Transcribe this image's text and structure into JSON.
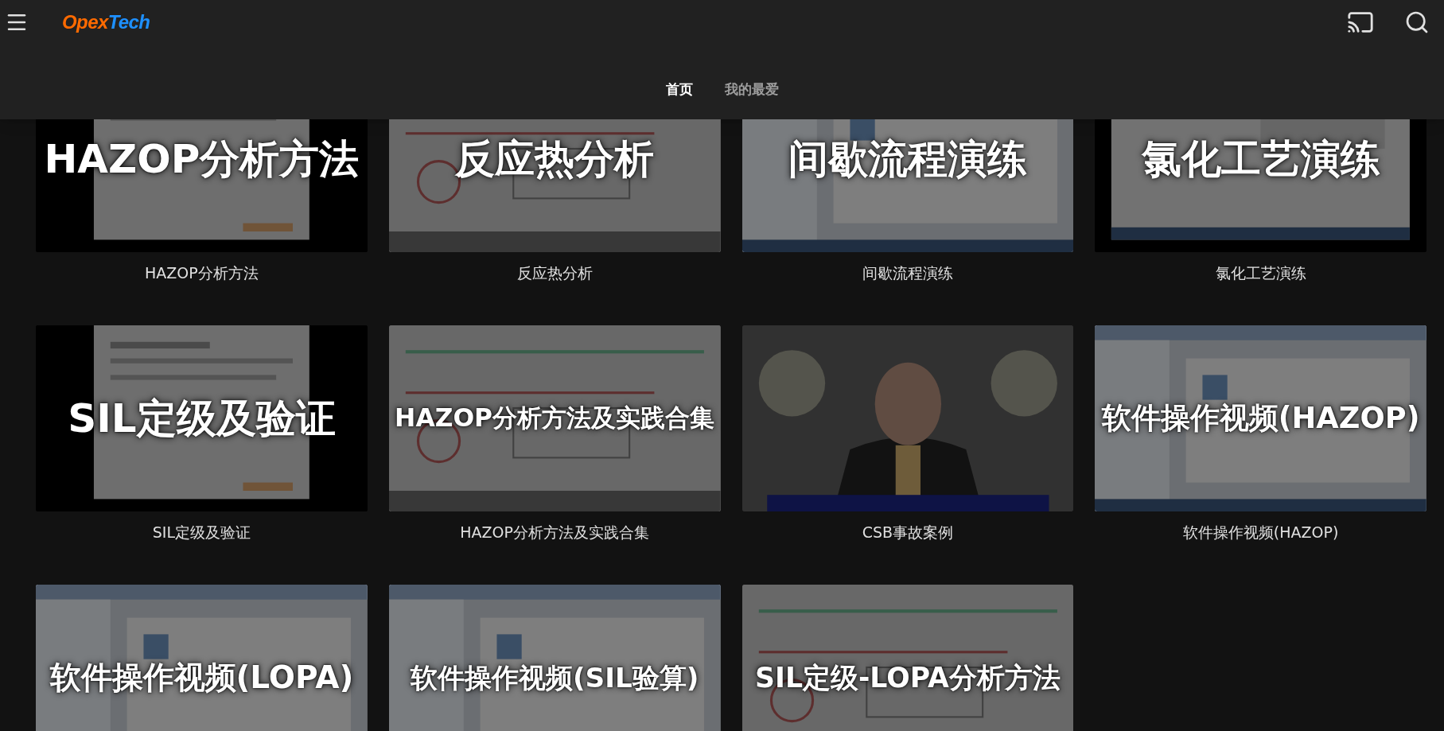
{
  "header": {
    "logo": [
      {
        "text": "Opex",
        "color": "#ff6a00"
      },
      {
        "text": "Tech",
        "color": "#1e90ff"
      }
    ],
    "tabs": [
      {
        "label": "首页",
        "selected": true
      },
      {
        "label": "我的最爱",
        "selected": false
      }
    ]
  },
  "videos": [
    {
      "overlay_title": "HAZOP分析方法",
      "caption": "HAZOP分析方法"
    },
    {
      "overlay_title": "反应热分析",
      "caption": "反应热分析"
    },
    {
      "overlay_title": "间歇流程演练",
      "caption": "间歇流程演练"
    },
    {
      "overlay_title": "氯化工艺演练",
      "caption": "氯化工艺演练"
    },
    {
      "overlay_title": "SIL定级及验证",
      "caption": "SIL定级及验证"
    },
    {
      "overlay_title": "HAZOP分析方法及实践合集",
      "caption": "HAZOP分析方法及实践合集"
    },
    {
      "caption": "CSB事故案例"
    },
    {
      "overlay_title": "软件操作视频(HAZOP)",
      "caption": "软件操作视频(HAZOP)"
    },
    {
      "overlay_title": "软件操作视频(LOPA)"
    },
    {
      "overlay_title": "软件操作视频(SIL验算)"
    },
    {
      "overlay_title": "SIL定级-LOPA分析方法"
    }
  ]
}
